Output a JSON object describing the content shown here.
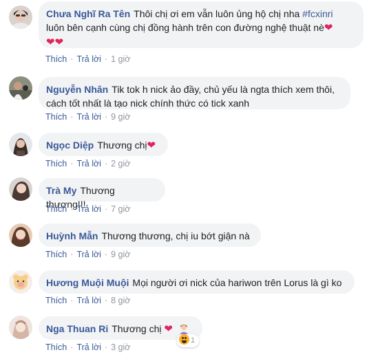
{
  "comments": [
    {
      "author": "Chưa Nghĩ Ra Tên",
      "text_line1": "Thôi chị ơi em vẫn luôn ủng hộ chị nha",
      "hashtag": "#fcxinri",
      "text_line2": "luôn bên cạnh cùng chị đồng hành trên con đường nghệ thuật nè",
      "hearts_line3": "❤❤",
      "like": "Thích",
      "reply": "Trả lời",
      "time": "1 giờ"
    },
    {
      "author": "Nguyễn Nhân",
      "text_line1": "Tik tok h nick ảo đầy, chủ yếu là ngta thích xem thôi,",
      "text_line2": "cách tốt nhất là tạo nick chính thức có tick xanh",
      "like": "Thích",
      "reply": "Trả lời",
      "time": "9 giờ"
    },
    {
      "author": "Ngọc Diệp",
      "text": "Thương chị",
      "emoji": "❤",
      "like": "Thích",
      "reply": "Trả lời",
      "time": "2 giờ"
    },
    {
      "author": "Trà My",
      "text": "Thương thương!!!",
      "like": "Thích",
      "reply": "Trả lời",
      "time": "7 giờ"
    },
    {
      "author": "Huỳnh Mẫn",
      "text": "Thương thương, chị iu bớt giận nà",
      "like": "Thích",
      "reply": "Trả lời",
      "time": "9 giờ"
    },
    {
      "author": "Hương Muội Muội",
      "text": "Mọi người ơi nick của hariwon trên Lorus là gì ko",
      "like": "Thích",
      "reply": "Trả lời",
      "time": "8 giờ"
    },
    {
      "author": "Nga Thuan Ri",
      "text": "Thương chị",
      "emoji": "❤",
      "like": "Thích",
      "reply": "Trả lời",
      "time": "3 giờ",
      "reaction_count": "1"
    }
  ],
  "separator": "·",
  "colors": {
    "author": "#385898",
    "bubble": "#f2f3f5",
    "meta": "#90949c",
    "heart": "#e0245e"
  }
}
